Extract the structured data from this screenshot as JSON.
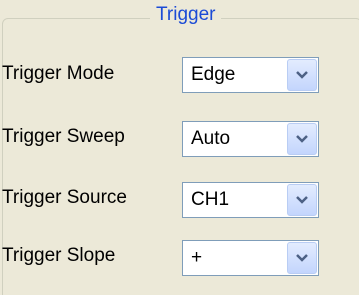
{
  "group": {
    "title": "Trigger"
  },
  "rows": [
    {
      "label": "Trigger Mode",
      "value": "Edge"
    },
    {
      "label": "Trigger Sweep",
      "value": "Auto"
    },
    {
      "label": "Trigger Source",
      "value": "CH1"
    },
    {
      "label": "Trigger Slope",
      "value": "+"
    }
  ],
  "icons": {
    "dropdown": "chevron-down-icon"
  },
  "colors": {
    "title": "#1b4bd6",
    "background": "#ece9d8",
    "combo_border": "#7f9db9",
    "chevron": "#4d6185"
  }
}
